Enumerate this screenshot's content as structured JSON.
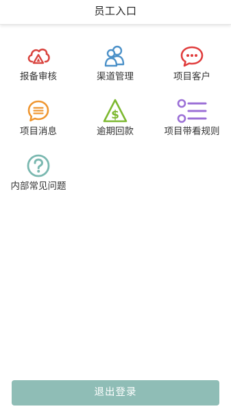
{
  "header": {
    "title": "员工入口"
  },
  "menu": {
    "items": [
      {
        "label": "报备审核",
        "icon": "cloud-upload-icon",
        "color": "#d9443f"
      },
      {
        "label": "渠道管理",
        "icon": "users-icon",
        "color": "#4a90c8"
      },
      {
        "label": "项目客户",
        "icon": "chat-bubble-icon",
        "color": "#e03c3c"
      },
      {
        "label": "项目消息",
        "icon": "message-icon",
        "color": "#ef9630"
      },
      {
        "label": "逾期回款",
        "icon": "dollar-warning-icon",
        "color": "#7cb82f"
      },
      {
        "label": "项目带看规则",
        "icon": "list-icon",
        "color": "#9b6fd6"
      },
      {
        "label": "内部常见问题",
        "icon": "help-circle-icon",
        "color": "#7ab8b0"
      }
    ]
  },
  "footer": {
    "logout_label": "退出登录",
    "logout_color": "#8fbdb6"
  }
}
